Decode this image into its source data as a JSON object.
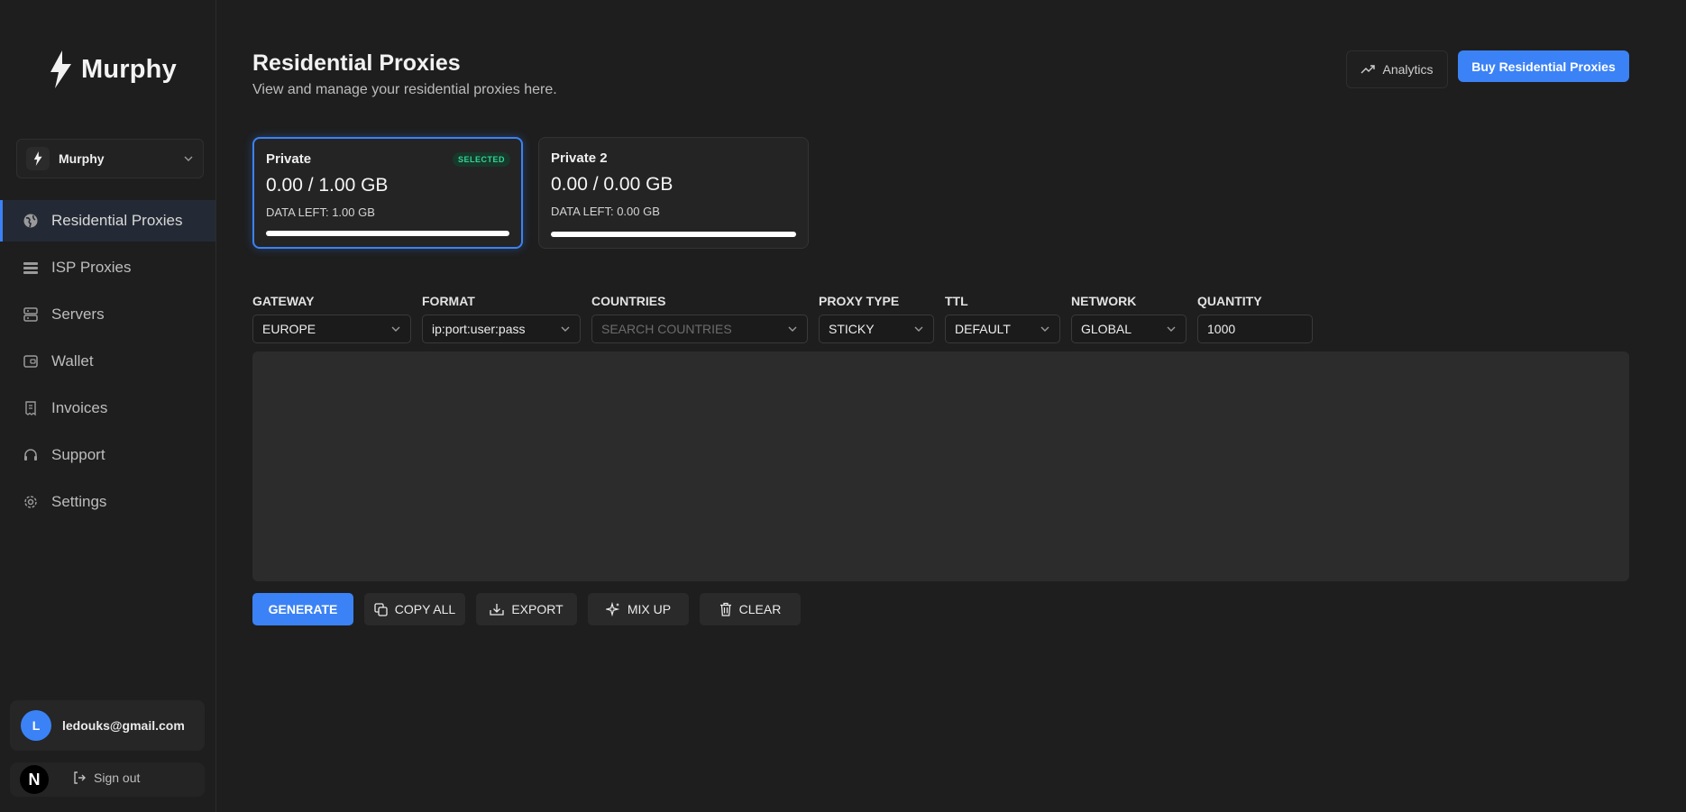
{
  "brand": {
    "name": "Murphy"
  },
  "org": {
    "name": "Murphy"
  },
  "nav": [
    {
      "label": "Residential Proxies",
      "icon": "globe-icon",
      "active": true
    },
    {
      "label": "ISP Proxies",
      "icon": "list-icon"
    },
    {
      "label": "Servers",
      "icon": "server-icon"
    },
    {
      "label": "Wallet",
      "icon": "wallet-icon"
    },
    {
      "label": "Invoices",
      "icon": "invoice-icon"
    },
    {
      "label": "Support",
      "icon": "headset-icon"
    },
    {
      "label": "Settings",
      "icon": "gear-icon"
    }
  ],
  "user": {
    "initial": "L",
    "email": "ledouks@gmail.com",
    "signout_label": "Sign out",
    "badge": "N"
  },
  "header": {
    "title": "Residential Proxies",
    "subtitle": "View and manage your residential proxies here.",
    "analytics_label": "Analytics",
    "buy_label": "Buy Residential Proxies"
  },
  "plans": [
    {
      "name": "Private",
      "usage": "0.00 / 1.00 GB",
      "data_left": "DATA LEFT: 1.00 GB",
      "badge": "SELECTED",
      "remaining_fraction": 1.0
    },
    {
      "name": "Private 2",
      "usage": "0.00 / 0.00 GB",
      "data_left": "DATA LEFT: 0.00 GB",
      "remaining_fraction": 1.0
    }
  ],
  "config": {
    "gateway": {
      "label": "GATEWAY",
      "value": "EUROPE"
    },
    "format": {
      "label": "FORMAT",
      "value": "ip:port:user:pass"
    },
    "countries": {
      "label": "COUNTRIES",
      "placeholder": "SEARCH COUNTRIES"
    },
    "proxy_type": {
      "label": "PROXY TYPE",
      "value": "STICKY"
    },
    "ttl": {
      "label": "TTL",
      "value": "DEFAULT"
    },
    "network": {
      "label": "NETWORK",
      "value": "GLOBAL"
    },
    "quantity": {
      "label": "QUANTITY",
      "value": "1000"
    }
  },
  "actions": {
    "generate": "GENERATE",
    "copy_all": "COPY ALL",
    "export": "EXPORT",
    "mix_up": "MIX UP",
    "clear": "CLEAR"
  },
  "colors": {
    "accent": "#3b82f6",
    "selected_badge": "#34d399",
    "background": "#1e1e1e"
  }
}
